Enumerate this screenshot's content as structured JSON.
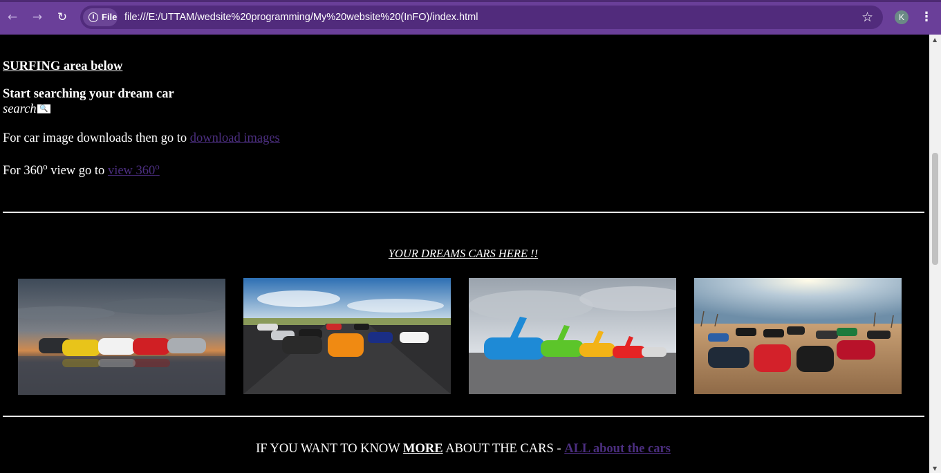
{
  "browser": {
    "url_scheme_label": "File",
    "url": "file:///E:/UTTAM/wedsite%20programming/My%20website%20(InFO)/index.html",
    "profile_initial": "K",
    "icons": {
      "back": "back-arrow-icon",
      "forward": "forward-arrow-icon",
      "reload": "reload-icon",
      "info": "info-icon",
      "bookmark": "star-icon",
      "menu": "kebab-menu-icon"
    }
  },
  "page": {
    "surfing_heading": "SURFING area below",
    "search_heading": "Start searching your dream car",
    "search_label": "search",
    "download_prefix": "For car image downloads then go to ",
    "download_link": "download images",
    "view360_prefix": "For 360",
    "view360_sup": "o",
    "view360_mid": " view go to ",
    "view360_link": "view 360",
    "view360_link_sup": "o",
    "dreams_caption": "YOUR DREAMS CARS HERE !!",
    "more_prefix": "IF YOU WANT TO KNOW ",
    "more_bold": "MORE",
    "more_suffix": " ABOUT THE CARS - ",
    "more_link": "ALL about the cars"
  },
  "colors": {
    "chrome": "#6a3f99",
    "page_bg": "#000000",
    "link": "#4b2e7f"
  }
}
